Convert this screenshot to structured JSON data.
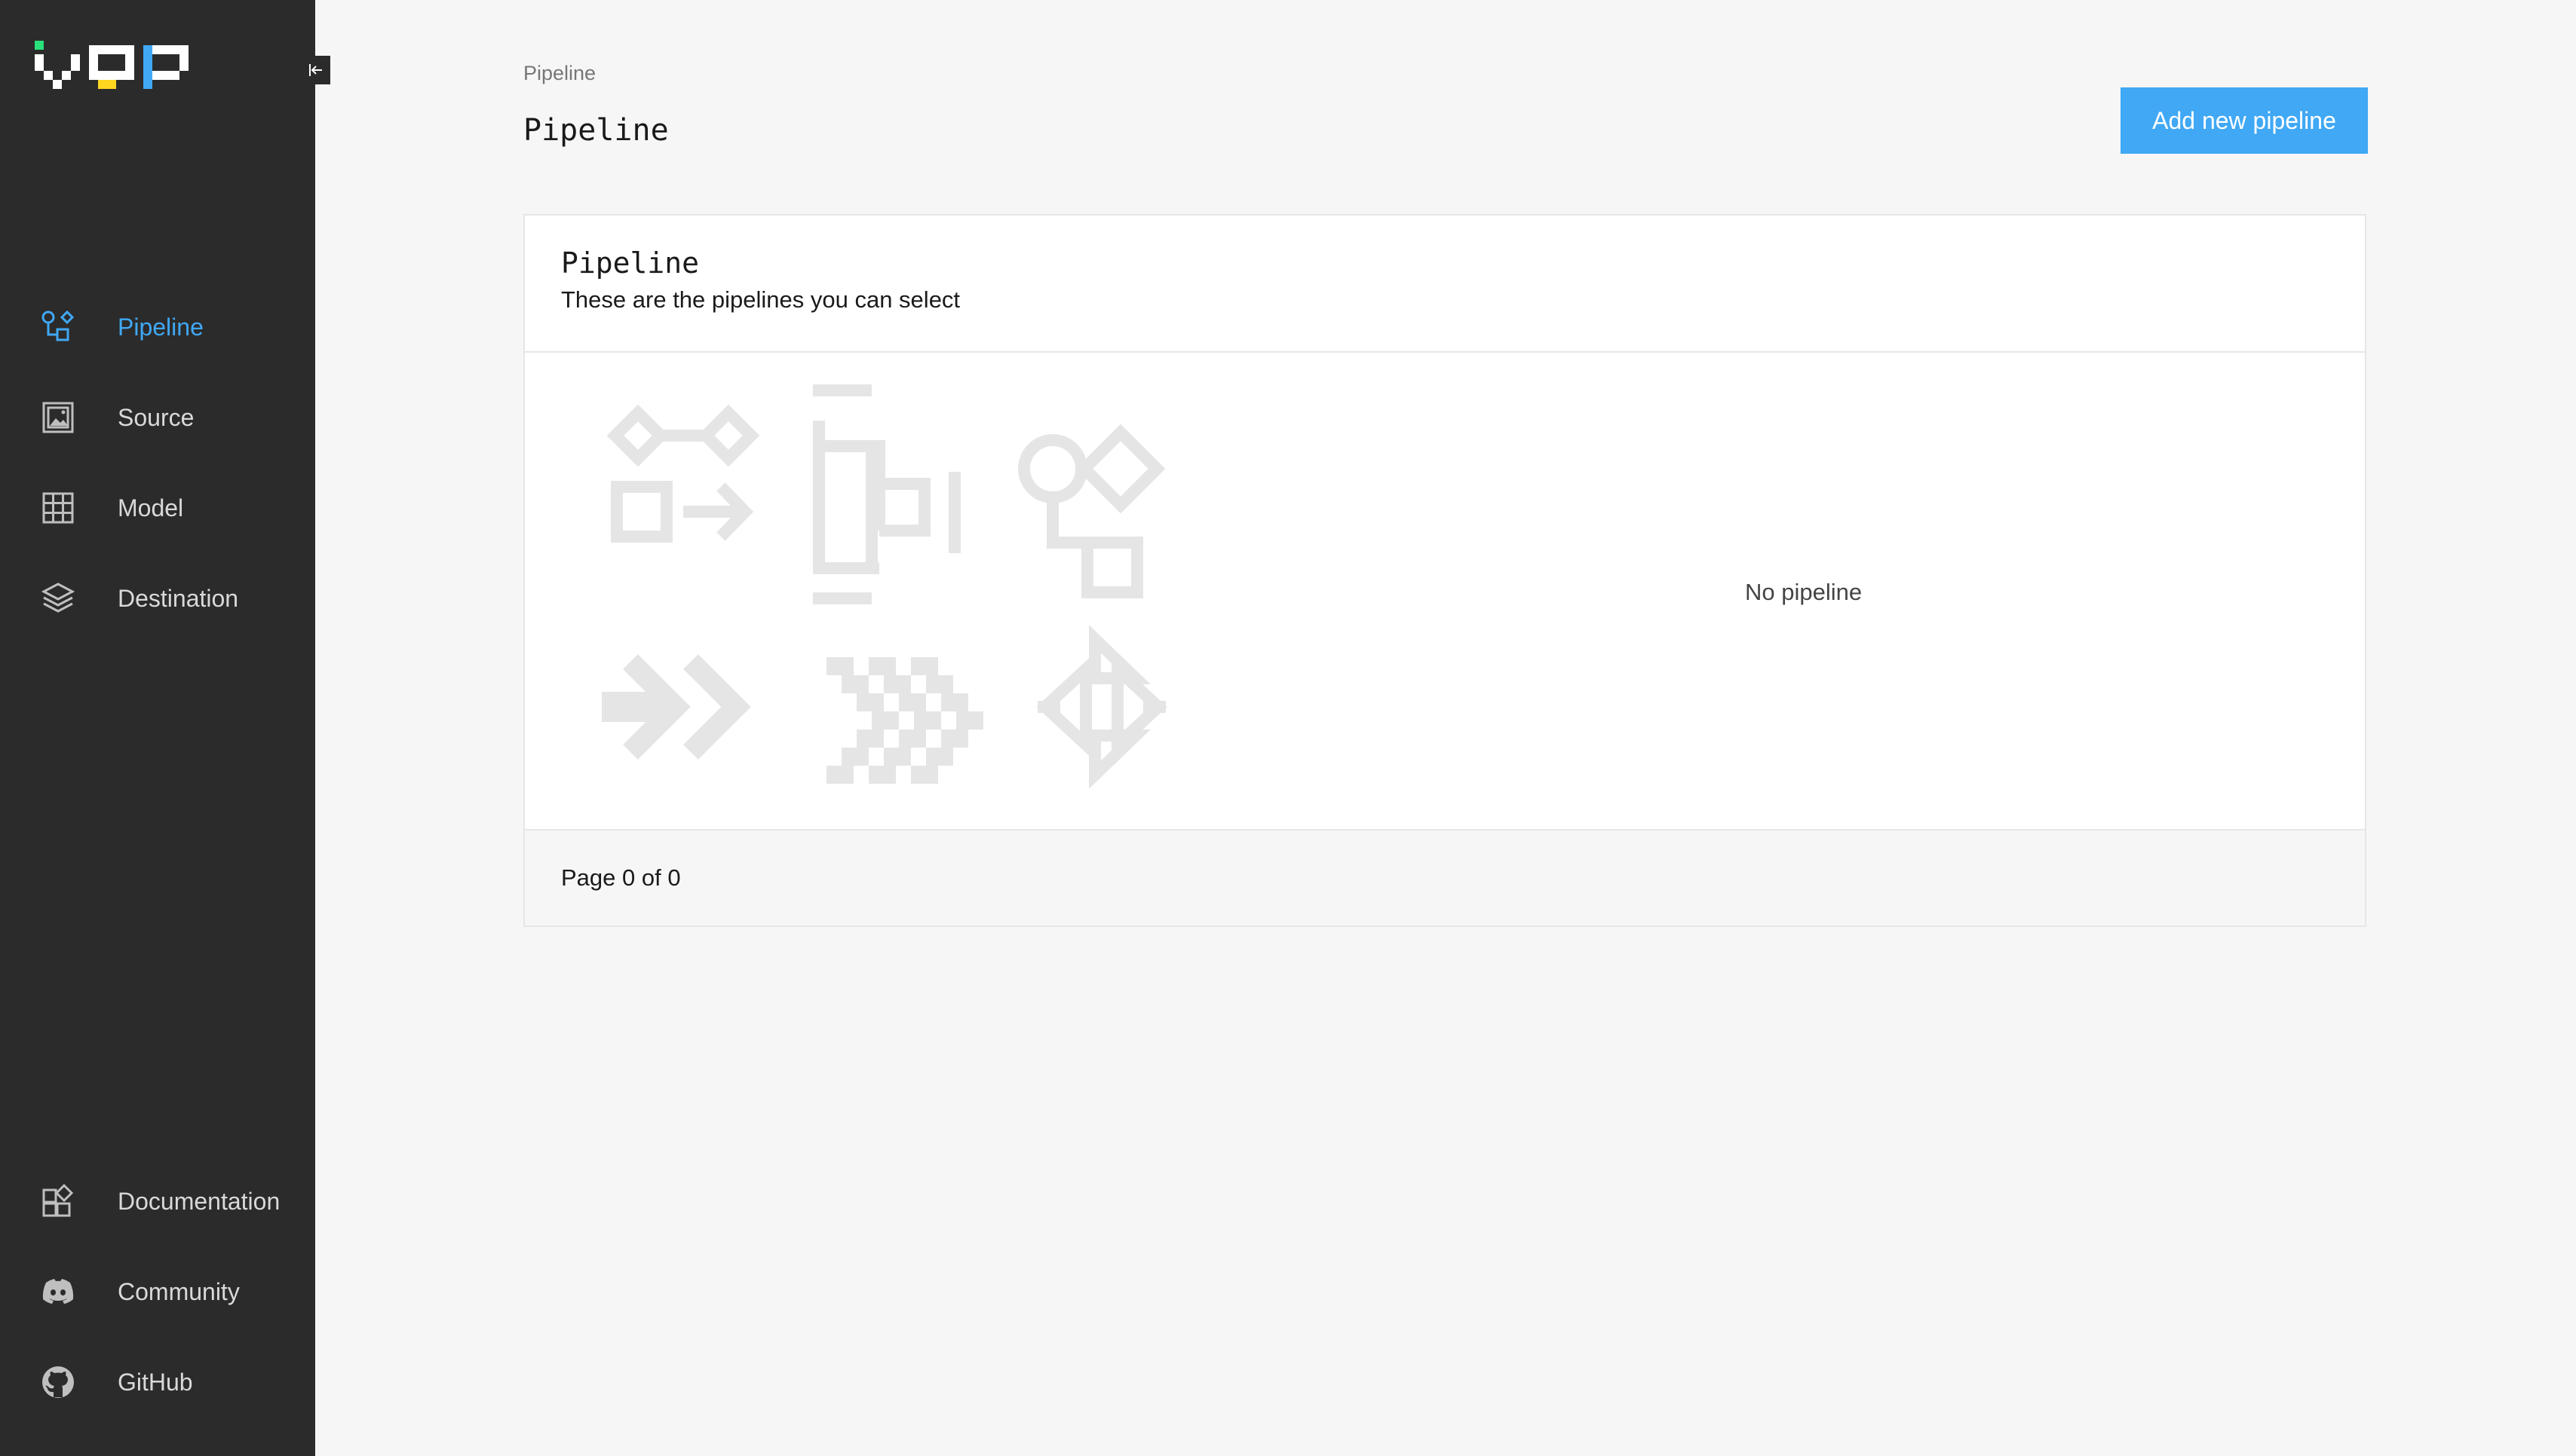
{
  "sidebar": {
    "logo_text": "VDP",
    "collapse_label": "⇤",
    "nav_top": [
      {
        "label": "Pipeline",
        "icon": "pipeline-icon",
        "active": true
      },
      {
        "label": "Source",
        "icon": "source-icon",
        "active": false
      },
      {
        "label": "Model",
        "icon": "model-icon",
        "active": false
      },
      {
        "label": "Destination",
        "icon": "destination-icon",
        "active": false
      }
    ],
    "nav_bottom": [
      {
        "label": "Documentation",
        "icon": "documentation-icon"
      },
      {
        "label": "Community",
        "icon": "discord-icon"
      },
      {
        "label": "GitHub",
        "icon": "github-icon"
      }
    ]
  },
  "header": {
    "breadcrumb": "Pipeline",
    "title": "Pipeline",
    "add_button_label": "Add new pipeline"
  },
  "table": {
    "title": "Pipeline",
    "description": "These are the pipelines you can select",
    "empty_message": "No pipeline",
    "pagination": "Page 0 of 0"
  },
  "colors": {
    "accent": "#40a8f5",
    "sidebar_bg": "#2b2b2b",
    "page_bg": "#f6f6f6",
    "empty_art": "#e5e5e5",
    "logo_green": "#29e07a",
    "logo_yellow": "#ffd61f",
    "logo_blue": "#40a8f5"
  }
}
